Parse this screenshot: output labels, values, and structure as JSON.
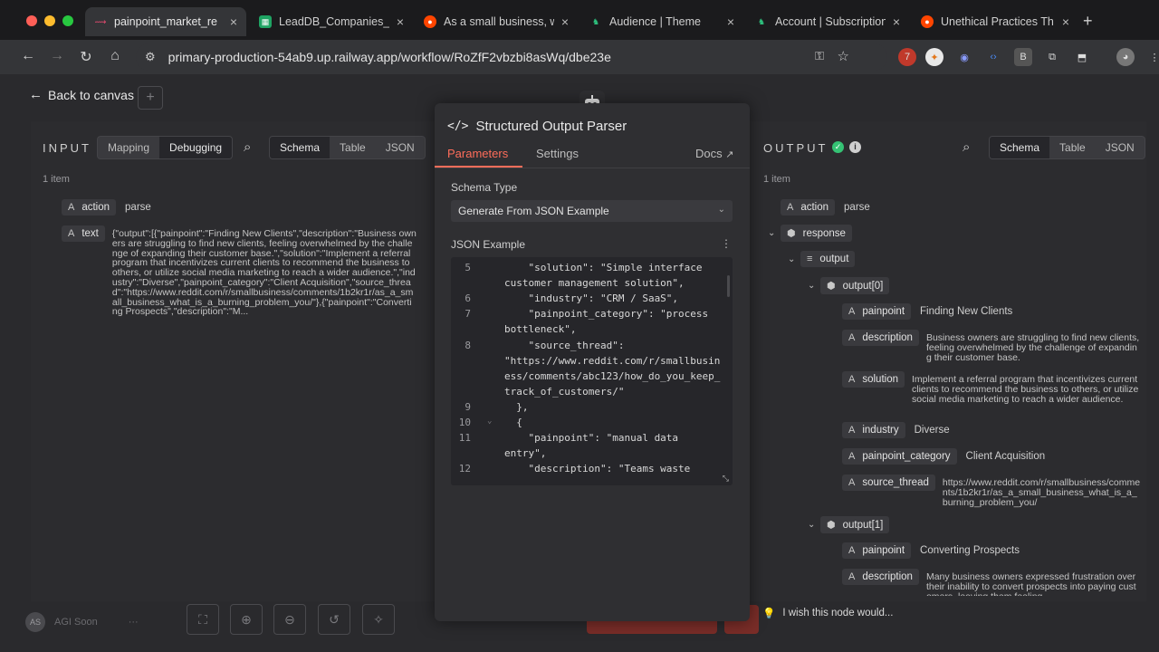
{
  "browser": {
    "tabs": [
      {
        "title": "painpoint_market_re",
        "favicon_color": "#ea4b71",
        "active": true
      },
      {
        "title": "LeadDB_Companies_U",
        "favicon_color": "#1fa463",
        "active": false
      },
      {
        "title": "As a small business, w",
        "favicon_color": "#ff4500",
        "active": false
      },
      {
        "title": "Audience | Theme",
        "favicon_color": "#2ec27e",
        "active": false
      },
      {
        "title": "Account | Subscription",
        "favicon_color": "#2ec27e",
        "active": false
      },
      {
        "title": "Unethical Practices Th",
        "favicon_color": "#ff4500",
        "active": false
      }
    ],
    "url": "primary-production-54ab9.up.railway.app/workflow/RoZfF2vbzbi8asWq/dbe23e",
    "ext_badge": "7"
  },
  "app": {
    "back_label": "Back to canvas",
    "input_panel": {
      "title": "INPUT",
      "mode_buttons": [
        "Mapping",
        "Debugging"
      ],
      "view_buttons": [
        "Schema",
        "Table",
        "JSON"
      ],
      "items_count": "1 item",
      "fields": [
        {
          "name": "action",
          "value": "parse"
        },
        {
          "name": "text",
          "value": "{\"output\":[{\"painpoint\":\"Finding New Clients\",\"description\":\"Business owners are struggling to find new clients, feeling overwhelmed by the challenge of expanding their customer base.\",\"solution\":\"Implement a referral program that incentivizes current clients to recommend the business to others, or utilize social media marketing to reach a wider audience.\",\"industry\":\"Diverse\",\"painpoint_category\":\"Client Acquisition\",\"source_thread\":\"https://www.reddit.com/r/smallbusiness/comments/1b2kr1r/as_a_small_business_what_is_a_burning_problem_you/\"},{\"painpoint\":\"Converting Prospects\",\"description\":\"M..."
        }
      ]
    },
    "node": {
      "title": "Structured Output Parser",
      "tabs": [
        "Parameters",
        "Settings"
      ],
      "docs_label": "Docs",
      "schema_type_label": "Schema Type",
      "schema_type_value": "Generate From JSON Example",
      "json_example_label": "JSON Example",
      "code_lines": [
        {
          "n": "5",
          "text": "    \"solution\": \"Simple interface"
        },
        {
          "n": "",
          "text": "customer management solution\","
        },
        {
          "n": "6",
          "text": "    \"industry\": \"CRM / SaaS\","
        },
        {
          "n": "7",
          "text": "    \"painpoint_category\": \"process"
        },
        {
          "n": "",
          "text": "bottleneck\","
        },
        {
          "n": "8",
          "text": "    \"source_thread\":"
        },
        {
          "n": "",
          "text": "\"https://www.reddit.com/r/smallbusin"
        },
        {
          "n": "",
          "text": "ess/comments/abc123/how_do_you_keep_"
        },
        {
          "n": "",
          "text": "track_of_customers/\""
        },
        {
          "n": "9",
          "text": "  },"
        },
        {
          "n": "10",
          "text": "  {"
        },
        {
          "n": "11",
          "text": "    \"painpoint\": \"manual data"
        },
        {
          "n": "",
          "text": "entry\","
        },
        {
          "n": "12",
          "text": "    \"description\": \"Teams waste"
        }
      ]
    },
    "output_panel": {
      "title": "OUTPUT",
      "view_buttons": [
        "Schema",
        "Table",
        "JSON"
      ],
      "items_count": "1 item",
      "action": {
        "name": "action",
        "value": "parse"
      },
      "response_label": "response",
      "output_label": "output",
      "output0_label": "output[0]",
      "output0": [
        {
          "name": "painpoint",
          "value": "Finding New Clients"
        },
        {
          "name": "description",
          "value": "Business owners are struggling to find new clients, feeling overwhelmed by the challenge of expanding their customer base."
        },
        {
          "name": "solution",
          "value": "Implement a referral program that incentivizes current clients to recommend the business to others, or utilize social media marketing to reach a wider audience."
        },
        {
          "name": "industry",
          "value": "Diverse"
        },
        {
          "name": "painpoint_category",
          "value": "Client Acquisition"
        },
        {
          "name": "source_thread",
          "value": "https://www.reddit.com/r/smallbusiness/comments/1b2kr1r/as_a_small_business_what_is_a_burning_problem_you/"
        }
      ],
      "output1_label": "output[1]",
      "output1": [
        {
          "name": "painpoint",
          "value": "Converting Prospects"
        },
        {
          "name": "description",
          "value": "Many business owners expressed frustration over their inability to convert prospects into paying customers, leaving them feeling"
        }
      ]
    },
    "footer": {
      "agi_label": "AGI Soon",
      "avatar_initials": "AS",
      "wish_label": "I wish this node would..."
    }
  }
}
